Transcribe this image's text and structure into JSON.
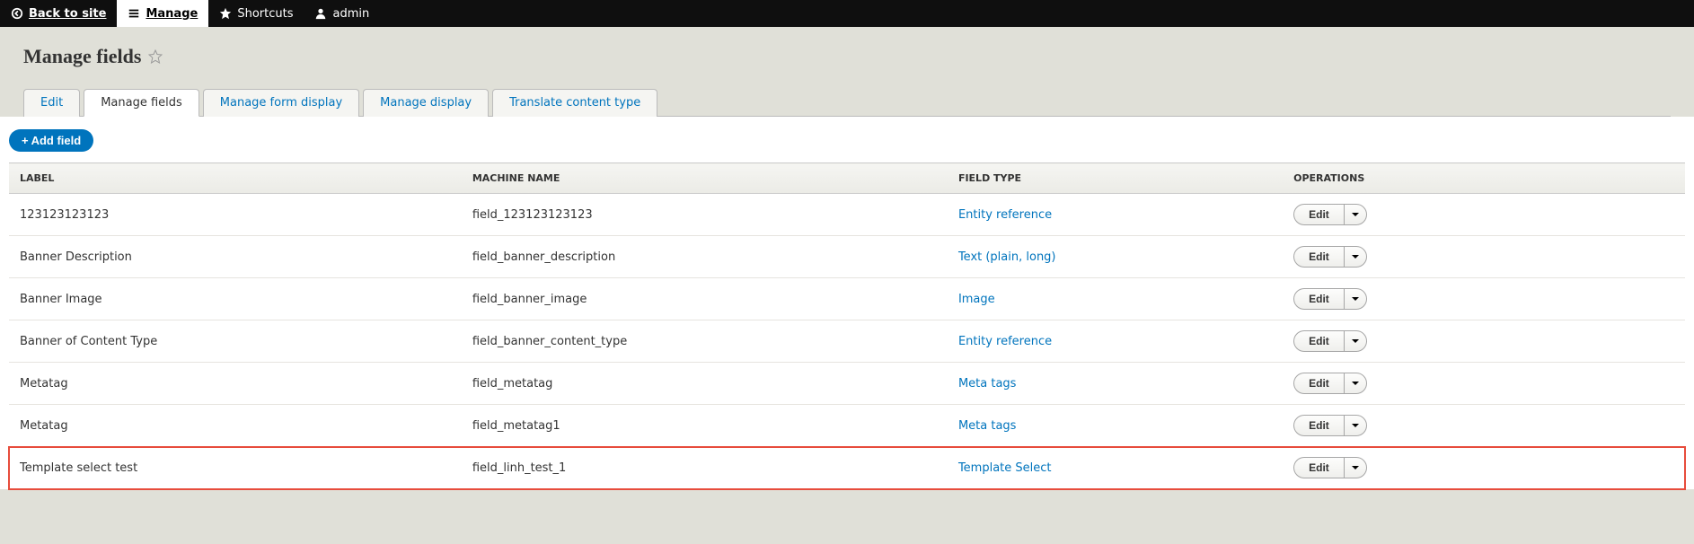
{
  "toolbar": {
    "back": "Back to site",
    "manage": "Manage",
    "shortcuts": "Shortcuts",
    "user": "admin"
  },
  "page": {
    "title": "Manage fields"
  },
  "tabs": [
    {
      "label": "Edit",
      "active": false
    },
    {
      "label": "Manage fields",
      "active": true
    },
    {
      "label": "Manage form display",
      "active": false
    },
    {
      "label": "Manage display",
      "active": false
    },
    {
      "label": "Translate content type",
      "active": false
    }
  ],
  "buttons": {
    "add_field": "Add field",
    "edit": "Edit"
  },
  "table": {
    "headers": {
      "label": "LABEL",
      "machine": "MACHINE NAME",
      "type": "FIELD TYPE",
      "ops": "OPERATIONS"
    },
    "rows": [
      {
        "label": "123123123123",
        "machine": "field_123123123123",
        "type": "Entity reference",
        "highlight": false
      },
      {
        "label": "Banner Description",
        "machine": "field_banner_description",
        "type": "Text (plain, long)",
        "highlight": false
      },
      {
        "label": "Banner Image",
        "machine": "field_banner_image",
        "type": "Image",
        "highlight": false
      },
      {
        "label": "Banner of Content Type",
        "machine": "field_banner_content_type",
        "type": "Entity reference",
        "highlight": false
      },
      {
        "label": "Metatag",
        "machine": "field_metatag",
        "type": "Meta tags",
        "highlight": false
      },
      {
        "label": "Metatag",
        "machine": "field_metatag1",
        "type": "Meta tags",
        "highlight": false
      },
      {
        "label": "Template select test",
        "machine": "field_linh_test_1",
        "type": "Template Select",
        "highlight": true
      }
    ]
  }
}
